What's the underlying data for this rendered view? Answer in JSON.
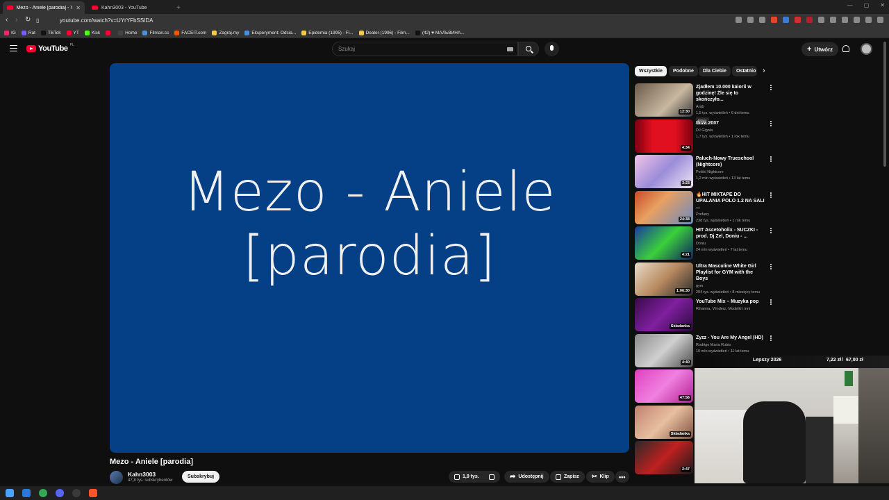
{
  "browser": {
    "tabs": [
      {
        "title": "Mezo - Aniele [parodia] - Yo",
        "active": true
      },
      {
        "title": "Kahn3003 - YouTube",
        "active": false
      }
    ],
    "new_tab": "+",
    "url": "youtube.com/watch?v=UYrYFbSSIDA",
    "bookmarks": [
      {
        "label": "IG",
        "color": "#e1306c"
      },
      {
        "label": "Rat",
        "color": "#7b5cff"
      },
      {
        "label": "TikTok",
        "color": "#222222"
      },
      {
        "label": "YT",
        "color": "#ff0033"
      },
      {
        "label": "Kick",
        "color": "#53fc18"
      },
      {
        "label": "",
        "color": "#ff0033"
      },
      {
        "label": "Home",
        "color": "#444444"
      },
      {
        "label": "Filman.cc",
        "color": "#4a90d9"
      },
      {
        "label": "FACEIT.com",
        "color": "#ff5500"
      },
      {
        "label": "Zagraj.my",
        "color": "#f2c94c"
      },
      {
        "label": "Eksperyment: Odsia...",
        "color": "#4a90d9"
      },
      {
        "label": "Epidemia (1995) - Fi...",
        "color": "#f2c94c"
      },
      {
        "label": "Dealer (1996) - Film...",
        "color": "#f2c94c"
      },
      {
        "label": "(42) ♥ МАЛЬВИНА...",
        "color": "#222222"
      }
    ]
  },
  "header": {
    "logo_text": "YouTube",
    "logo_country": "PL",
    "search_placeholder": "Szukaj",
    "create_label": "Utwórz"
  },
  "player": {
    "video_text_line1": "Mezo - Aniele",
    "video_text_line2": "[parodia]",
    "bg_color": "#053f86"
  },
  "video": {
    "title": "Mezo - Aniele [parodia]",
    "channel": "Kahn3003",
    "subscribers": "47,8 tys. subskrybentów",
    "subscribe_label": "Subskrybuj",
    "likes": "1,9 tys.",
    "share_label": "Udostępnij",
    "save_label": "Zapisz",
    "clip_label": "Klip"
  },
  "chips": [
    "Wszystkie",
    "Podobne",
    "Dla Ciebie",
    "Ostatnio"
  ],
  "recommendations": [
    {
      "title": "Zjadłem 10.000 kalorii w godzinę! Źle się to skończyło...",
      "channel": "Arab",
      "meta": "1,5 tys. wyświetleń • 6 dni temu",
      "badge": "Nowy",
      "duration": "12:30",
      "thumb": "linear-gradient(135deg,#6b5a4a,#c9b8a0 60%,#3a3a3a)"
    },
    {
      "title": "Ibiza 2007",
      "channel": "DJ Gigola",
      "meta": "1,7 tys. wyświetleń • 1 rok temu",
      "badge": "",
      "duration": "4:34",
      "thumb": "linear-gradient(90deg,#7a0010,#e01020 30%,#e01020 70%,#7a0010)"
    },
    {
      "title": "Paluch-Nowy Trueschool (Nightcore)",
      "channel": "Polski Nightcore",
      "meta": "1,2 mln wyświetleń • 13 lat temu",
      "badge": "",
      "duration": "3:23",
      "thumb": "linear-gradient(135deg,#f3c3e8,#9a8cd8 50%,#f0e8f6)"
    },
    {
      "title": "🔥HIT MIXTAPE DO UPALANIA POLO 1.2 NA SALI ...",
      "channel": "Prefany",
      "meta": "238 tys. wyświetleń • 1 rok temu",
      "badge": "",
      "duration": "24:38",
      "thumb": "linear-gradient(135deg,#c84a2a,#e8a060 40%,#6a8ac0)"
    },
    {
      "title": "HIT Ascetoholix - SUCZKI - prod. Dj Zel, Doniu - ...",
      "channel": "Doniu",
      "meta": "24 mln wyświetleń • 7 lat temu",
      "badge": "",
      "duration": "4:21",
      "thumb": "linear-gradient(135deg,#1a3aa0,#3ad03a 50%,#102060)"
    },
    {
      "title": "Ultra Masculine White Girl Playlist for GYM with the Boys",
      "channel": "gym",
      "meta": "204 tys. wyświetleń • 8 miesięcy temu",
      "badge": "",
      "duration": "1:06:30",
      "thumb": "linear-gradient(135deg,#e8dcc8,#b88a60 50%,#2a2a2a)"
    },
    {
      "title": "YouTube Mix – Muzyka pop",
      "channel": "Rihanna, Vlinderz, Modelki i inni",
      "meta": "",
      "badge": "",
      "duration": "Składanka",
      "thumb": "linear-gradient(135deg,#3a0a4a,#8020a0 50%,#2a0a3a)"
    },
    {
      "title": "Zyzz - You Are My Angel (HD)",
      "channel": "Rodrigo Maria Rubio",
      "meta": "10 mln wyświetleń • 11 lat temu",
      "badge": "",
      "duration": "4:40",
      "thumb": "linear-gradient(135deg,#8a8a8a,#d0d0d0 50%,#4a4a4a)"
    },
    {
      "title": "",
      "channel": "",
      "meta": "",
      "badge": "",
      "duration": "47:56",
      "thumb": "linear-gradient(135deg,#e040c0,#f080e0 50%,#b02090)"
    },
    {
      "title": "",
      "channel": "",
      "meta": "",
      "badge": "",
      "duration": "Składanka",
      "thumb": "linear-gradient(135deg,#c08070,#e8c0a0 50%,#805040)"
    },
    {
      "title": "",
      "channel": "",
      "meta": "",
      "badge": "",
      "duration": "2:47",
      "thumb": "linear-gradient(135deg,#2a2a2a,#c02020 50%,#1a1a1a)"
    }
  ],
  "overlay": {
    "label": "Lepszy 2026",
    "amount": "7,22 zł",
    "goal": "67,00 zł"
  }
}
